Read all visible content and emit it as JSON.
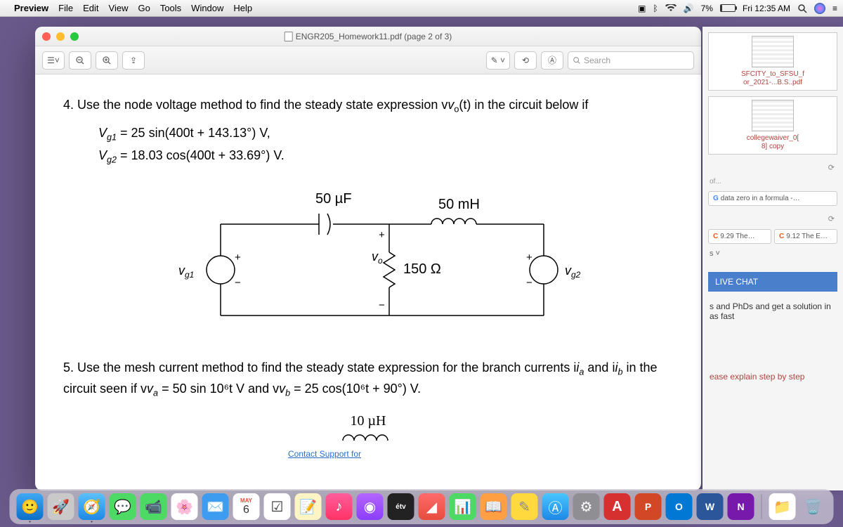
{
  "menubar": {
    "app_name": "Preview",
    "menus": [
      "File",
      "Edit",
      "View",
      "Go",
      "Tools",
      "Window",
      "Help"
    ],
    "battery_percent": "7%",
    "clock": "Fri 12:35 AM"
  },
  "window": {
    "title": "ENGR205_Homework11.pdf (page 2 of 3)",
    "search_placeholder": "Search"
  },
  "document": {
    "q4_prompt": "4. Use the node voltage method to find the steady state expression v",
    "q4_sub": "o",
    "q4_rest": "(t) in the circuit below if",
    "eq1_a": "V",
    "eq1_sub": "g1",
    "eq1_b": " = 25 sin(400t + 143.13°) V,",
    "eq2_a": "V",
    "eq2_sub": "g2",
    "eq2_b": " = 18.03 cos(400t + 33.69°) V.",
    "cap_label": "50 µF",
    "ind_label": "50 mH",
    "res_label": "150 Ω",
    "vg1_label": "vg1",
    "vg2_label": "vg2",
    "vo_label": "vo",
    "q5_text_a": "5. Use the mesh current method to find the steady state expression for the branch currents i",
    "q5_sub_a": "a",
    "q5_text_b": " and i",
    "q5_sub_b": "b",
    "q5_text_c": " in the circuit seen if v",
    "q5_sub_c": "a",
    "q5_text_d": " = 50 sin 10⁶t V and v",
    "q5_sub_d": "b",
    "q5_text_e": " = 25 cos(10⁶t + 90°) V.",
    "ind2_label": "10 µH",
    "support_link": "Contact Support for"
  },
  "side": {
    "thumb1_a": "SFCITY_to_SFSU_f",
    "thumb1_b": "or_2021-...B.S..pdf",
    "thumb2_a": "collegewaiver_0[",
    "thumb2_b": "8] copy",
    "ref_text": "of...",
    "tab_g": "data zero in a formula -…",
    "tab_c1": "9.29 The…",
    "tab_c2": "9.12 The E…",
    "s_chev": "s ˅",
    "live_chat": "LIVE CHAT",
    "phd": "s and PhDs and get a solution in as fast",
    "explain": "ease explain step by step"
  },
  "dock": {
    "apps": [
      "finder",
      "launchpad",
      "safari",
      "messages",
      "facetime",
      "mail",
      "photos",
      "contacts",
      "calendar",
      "reminders",
      "notes",
      "music",
      "podcasts",
      "tv",
      "appstore",
      "numbers",
      "pages",
      "keynote",
      "chegg",
      "autodesk",
      "anaconda",
      "preview",
      "word",
      "onenote",
      "settings",
      "trash"
    ]
  }
}
